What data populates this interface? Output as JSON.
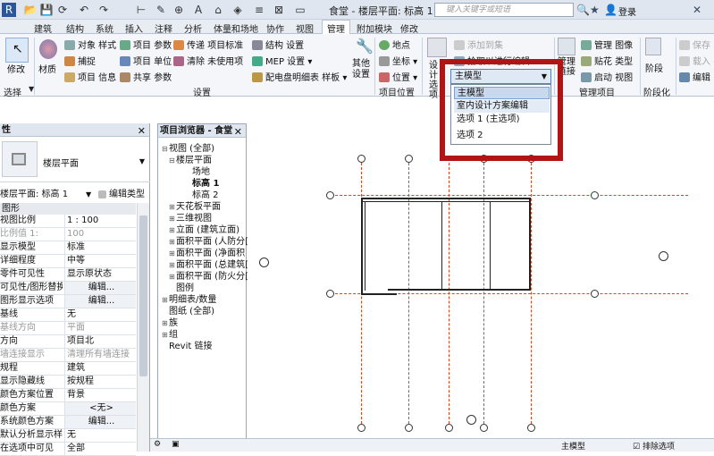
{
  "titlebar": {
    "title": "食堂 - 楼层平面: 标高 1",
    "search_placeholder": "键入关键字或短语",
    "login": "登录"
  },
  "tabs": [
    "建筑",
    "结构",
    "系统",
    "插入",
    "注释",
    "分析",
    "体量和场地",
    "协作",
    "视图",
    "管理",
    "附加模块",
    "修改"
  ],
  "active_tab": "管理",
  "ribbon": {
    "select": {
      "modify": "修改",
      "panel": "选择"
    },
    "settings": {
      "material": "材质",
      "object_style": "对象 样式",
      "snap": "捕捉",
      "project_info": "项目 信息",
      "project_params": "项目 参数",
      "project_units": "项目 单位",
      "shared_params": "共享 参数",
      "transfer_standards": "传递 项目标准",
      "purge_unused": "清除 未使用项",
      "structural_settings": "结构 设置",
      "mep_settings": "MEP 设置",
      "panel_schedule": "配电盘明细表 样板",
      "other_settings": "其他 设置",
      "panel": "设置"
    },
    "project_location": {
      "location": "地点",
      "coordinates": "坐标",
      "position": "位置",
      "panel": "项目位置"
    },
    "design_options": {
      "label": "设计 选项",
      "add_to_set": "添加到集",
      "pick_to_edit": "拾取以进行编辑"
    },
    "manage_project": {
      "manage_images": "管理 图像",
      "decal_types": "贴花 类型",
      "starting_view": "启动 视图",
      "manage_links": "管理 链接",
      "panel": "管理项目"
    },
    "phasing": {
      "phases": "阶段",
      "panel": "阶段化"
    },
    "selection": {
      "save": "保存",
      "load": "载入",
      "edit": "编辑"
    }
  },
  "properties": {
    "title": "性",
    "type_name": "楼层平面",
    "instance": "楼层平面: 标高 1",
    "edit_type": "编辑类型",
    "group": "图形",
    "rows": [
      {
        "k": "视图比例",
        "v": "1 : 100"
      },
      {
        "k": "比例值 1:",
        "v": "100",
        "gray": true
      },
      {
        "k": "显示模型",
        "v": "标准"
      },
      {
        "k": "详细程度",
        "v": "中等"
      },
      {
        "k": "零件可见性",
        "v": "显示原状态"
      },
      {
        "k": "可见性/图形替换",
        "v": "编辑...",
        "btn": true
      },
      {
        "k": "图形显示选项",
        "v": "编辑...",
        "btn": true
      },
      {
        "k": "基线",
        "v": "无"
      },
      {
        "k": "基线方向",
        "v": "平面",
        "gray": true
      },
      {
        "k": "方向",
        "v": "项目北"
      },
      {
        "k": "墙连接显示",
        "v": "清理所有墙连接",
        "gray": true
      },
      {
        "k": "规程",
        "v": "建筑"
      },
      {
        "k": "显示隐藏线",
        "v": "按规程"
      },
      {
        "k": "颜色方案位置",
        "v": "背景"
      },
      {
        "k": "颜色方案",
        "v": "<无>",
        "btn": true
      },
      {
        "k": "系统颜色方案",
        "v": "编辑...",
        "btn": true
      },
      {
        "k": "默认分析显示样式",
        "v": "无"
      },
      {
        "k": "在选项中可见",
        "v": "全部"
      }
    ]
  },
  "browser": {
    "title": "项目浏览器 - 食堂",
    "items": [
      {
        "label": "视图 (全部)",
        "exp": "⊟"
      },
      {
        "label": "楼层平面",
        "exp": "⊟"
      },
      {
        "label": "场地",
        "exp": ""
      },
      {
        "label": "标高 1",
        "exp": "",
        "bold": true
      },
      {
        "label": "标高 2",
        "exp": ""
      },
      {
        "label": "天花板平面",
        "exp": "⊞"
      },
      {
        "label": "三维视图",
        "exp": "⊞"
      },
      {
        "label": "立面 (建筑立面)",
        "exp": "⊞"
      },
      {
        "label": "面积平面 (人防分[",
        "exp": "⊞"
      },
      {
        "label": "面积平面 (净面积",
        "exp": "⊞"
      },
      {
        "label": "面积平面 (总建筑[",
        "exp": "⊞"
      },
      {
        "label": "面积平面 (防火分[",
        "exp": "⊞"
      },
      {
        "label": "图例",
        "exp": ""
      },
      {
        "label": "明细表/数量",
        "exp": "⊞"
      },
      {
        "label": "图纸 (全部)",
        "exp": ""
      },
      {
        "label": "族",
        "exp": "⊞"
      },
      {
        "label": "组",
        "exp": "⊞"
      },
      {
        "label": "Revit 链接",
        "exp": ""
      }
    ]
  },
  "dropdown": {
    "current": "主模型",
    "options": [
      "主模型",
      "室内设计方案编辑",
      "选项 1 (主选项)",
      "选项 2"
    ],
    "selected_index": 0,
    "hover_index": 1
  },
  "status": {
    "model": "主模型",
    "exclude": "排除选项"
  }
}
